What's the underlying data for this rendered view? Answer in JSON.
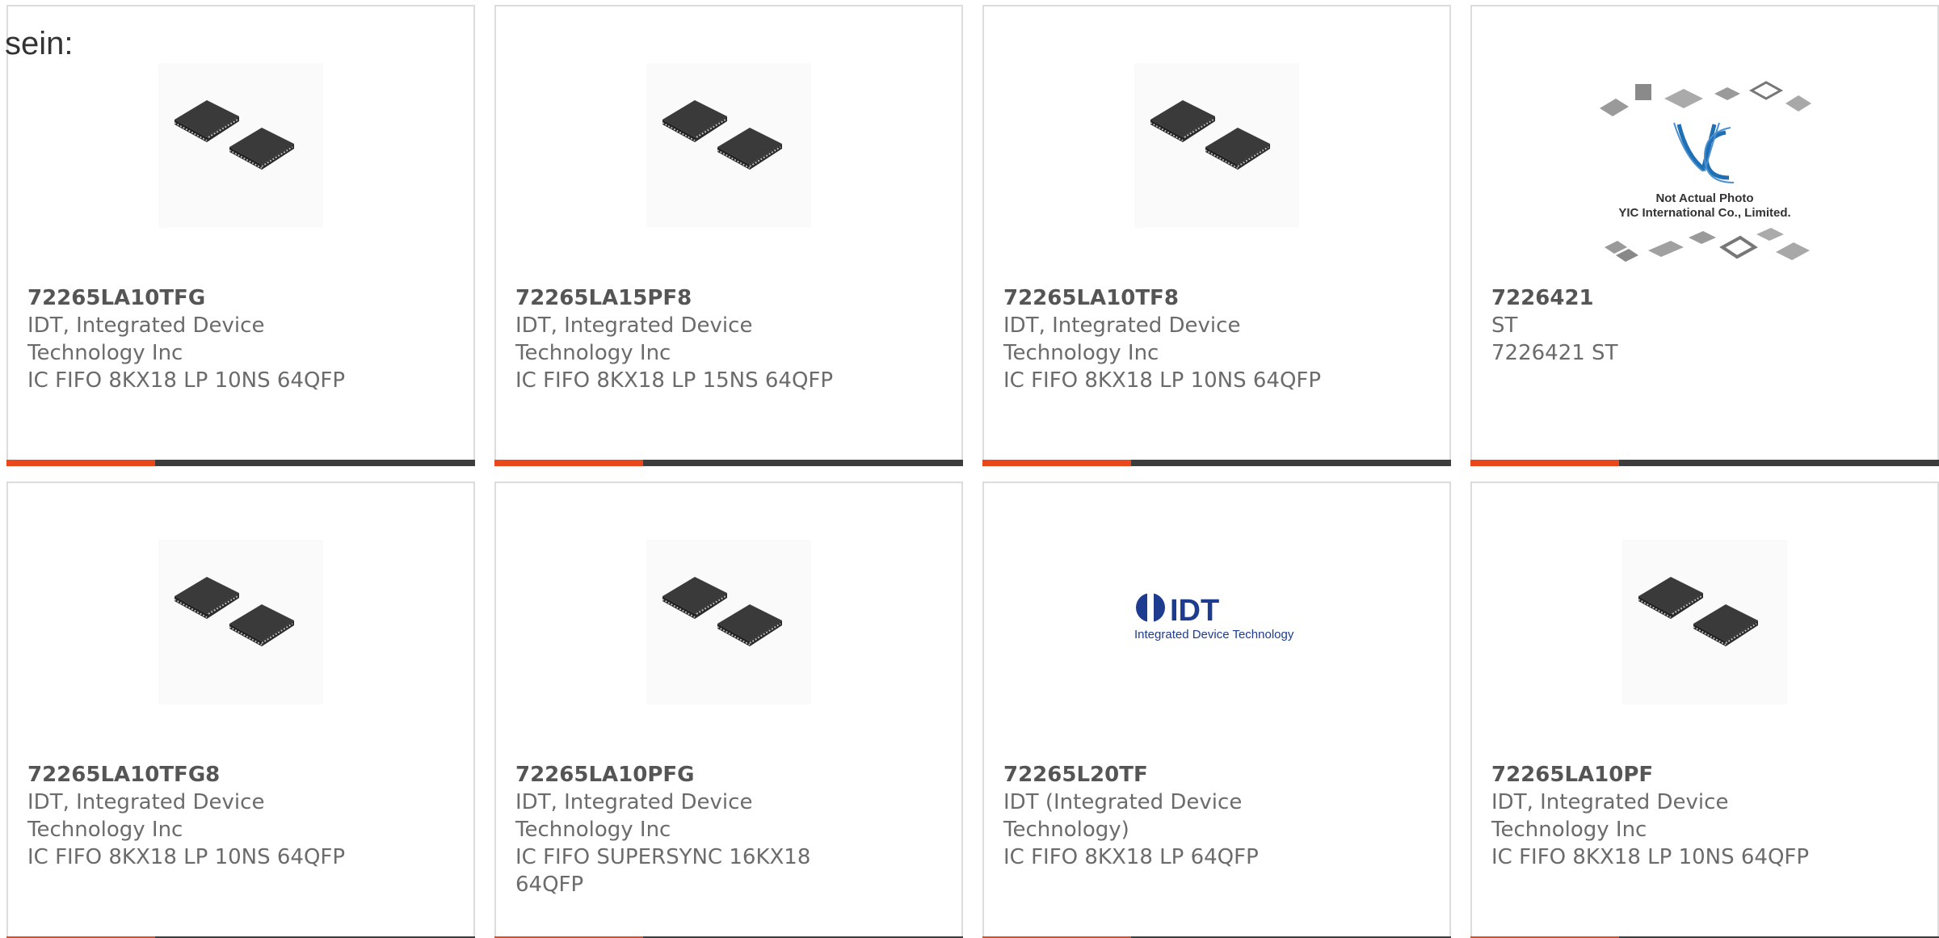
{
  "heading": {
    "text": "sein:"
  },
  "colors": {
    "accent": "#e8481c",
    "bar": "#3d3d3d",
    "border": "#dcdcdc"
  },
  "products": [
    {
      "part_number": "72265LA10TFG",
      "manufacturer": "IDT, Integrated Device Technology Inc",
      "description": "IC FIFO 8KX18 LP 10NS 64QFP",
      "image": "qfp-chip-photo"
    },
    {
      "part_number": "72265LA15PF8",
      "manufacturer": "IDT, Integrated Device Technology Inc",
      "description": "IC FIFO 8KX18 LP 15NS 64QFP",
      "image": "qfp-chip-photo"
    },
    {
      "part_number": "72265LA10TF8",
      "manufacturer": "IDT, Integrated Device Technology Inc",
      "description": "IC FIFO 8KX18 LP 10NS 64QFP",
      "image": "qfp-chip-photo"
    },
    {
      "part_number": "7226421",
      "manufacturer": "ST",
      "description": "7226421 ST",
      "image": "not-actual-photo",
      "image_text": {
        "line1": "Not Actual Photo",
        "line2": "YIC International Co., Limited.",
        "logo": "YIC"
      }
    },
    {
      "part_number": "72265LA10TFG8",
      "manufacturer": "IDT, Integrated Device Technology Inc",
      "description": "IC FIFO 8KX18 LP 10NS 64QFP",
      "image": "qfp-chip-photo"
    },
    {
      "part_number": "72265LA10PFG",
      "manufacturer": "IDT, Integrated Device Technology Inc",
      "description": "IC FIFO SUPERSYNC 16KX18 64QFP",
      "image": "qfp-chip-photo"
    },
    {
      "part_number": "72265L20TF",
      "manufacturer": "IDT (Integrated Device Technology)",
      "description": "IC FIFO 8KX18 LP 64QFP",
      "image": "idt-logo",
      "image_text": {
        "logo": "IDT",
        "tagline": "Integrated Device Technology"
      }
    },
    {
      "part_number": "72265LA10PF",
      "manufacturer": "IDT, Integrated Device Technology Inc",
      "description": "IC FIFO 8KX18 LP 10NS 64QFP",
      "image": "qfp-chip-photo"
    }
  ]
}
